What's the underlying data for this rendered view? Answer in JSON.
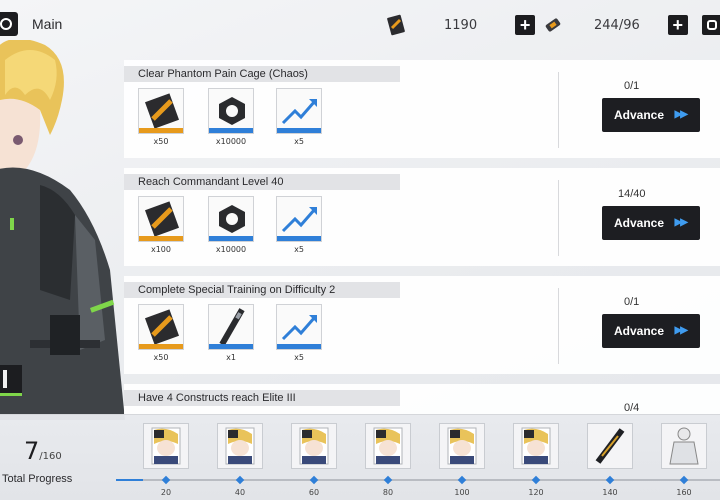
{
  "header": {
    "title": "Main",
    "currency_value": "1190",
    "stamina_value": "244/96"
  },
  "tasks": [
    {
      "title": "Clear Phantom Pain Cage (Chaos)",
      "progress": "0/1",
      "button": "Advance",
      "rewards": [
        {
          "icon": "gold-ticket-icon",
          "qty": "x50"
        },
        {
          "icon": "hex-nut-icon",
          "qty": "x10000"
        },
        {
          "icon": "supply-arrow-icon",
          "qty": "x5"
        }
      ]
    },
    {
      "title": "Reach Commandant Level 40",
      "progress": "14/40",
      "button": "Advance",
      "rewards": [
        {
          "icon": "gold-ticket-icon",
          "qty": "x100"
        },
        {
          "icon": "hex-nut-icon",
          "qty": "x10000"
        },
        {
          "icon": "supply-arrow-icon",
          "qty": "x5"
        }
      ]
    },
    {
      "title": "Complete Special Training on Difficulty 2",
      "progress": "0/1",
      "button": "Advance",
      "rewards": [
        {
          "icon": "gold-ticket-icon",
          "qty": "x50"
        },
        {
          "icon": "supply-stick-icon",
          "qty": "x1"
        },
        {
          "icon": "supply-arrow-icon",
          "qty": "x5"
        }
      ]
    },
    {
      "title": "Have 4 Constructs reach Elite III",
      "progress": "0/4"
    }
  ],
  "total": {
    "current": "7",
    "max": "/160",
    "label": "Total Progress",
    "fraction": 0.044
  },
  "milestones": [
    {
      "value": "20",
      "icon": "character-card-icon"
    },
    {
      "value": "40",
      "icon": "character-card-icon"
    },
    {
      "value": "60",
      "icon": "character-card-icon"
    },
    {
      "value": "80",
      "icon": "character-card-icon"
    },
    {
      "value": "100",
      "icon": "character-card-icon"
    },
    {
      "value": "120",
      "icon": "character-card-icon"
    },
    {
      "value": "140",
      "icon": "weapon-icon"
    },
    {
      "value": "160",
      "icon": "outfit-icon"
    }
  ],
  "colors": {
    "accent_blue": "#2f7fd8",
    "button_dark": "#1d1e22",
    "gold": "#e79a1c"
  }
}
